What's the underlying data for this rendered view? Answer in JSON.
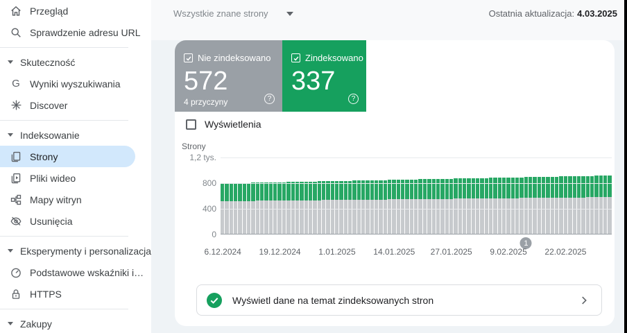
{
  "topbar": {
    "filter_label": "Wszystkie znane strony",
    "last_update_label": "Ostatnia aktualizacja:",
    "last_update_date": "4.03.2025"
  },
  "sidebar": {
    "items": [
      {
        "type": "item",
        "slug": "overview",
        "icon": "home-icon",
        "label": "Przegląd"
      },
      {
        "type": "item",
        "slug": "url-inspection",
        "icon": "search-icon",
        "label": "Sprawdzenie adresu URL"
      },
      {
        "type": "divider"
      },
      {
        "type": "section",
        "slug": "performance",
        "label": "Skuteczność"
      },
      {
        "type": "item",
        "slug": "search-results",
        "icon": "google-g-icon",
        "label": "Wyniki wyszukiwania"
      },
      {
        "type": "item",
        "slug": "discover",
        "icon": "discover-icon",
        "label": "Discover"
      },
      {
        "type": "divider"
      },
      {
        "type": "section",
        "slug": "indexing",
        "label": "Indeksowanie"
      },
      {
        "type": "item",
        "slug": "pages",
        "icon": "pages-icon",
        "label": "Strony",
        "selected": true
      },
      {
        "type": "item",
        "slug": "video-pages",
        "icon": "video-icon",
        "label": "Pliki wideo"
      },
      {
        "type": "item",
        "slug": "sitemaps",
        "icon": "sitemap-icon",
        "label": "Mapy witryn"
      },
      {
        "type": "item",
        "slug": "removals",
        "icon": "eye-off-icon",
        "label": "Usunięcia"
      },
      {
        "type": "divider"
      },
      {
        "type": "section",
        "slug": "experience",
        "label": "Eksperymenty i personalizacja"
      },
      {
        "type": "item",
        "slug": "core-web-vitals",
        "icon": "gauge-icon",
        "label": "Podstawowe wskaźniki i…"
      },
      {
        "type": "item",
        "slug": "https",
        "icon": "lock-icon",
        "label": "HTTPS"
      },
      {
        "type": "divider"
      },
      {
        "type": "section",
        "slug": "shopping",
        "label": "Zakupy"
      }
    ]
  },
  "summary_cards": {
    "not_indexed": {
      "label": "Nie zindeksowano",
      "value": 572,
      "subtitle": "4 przyczyny",
      "color": "#9aa0a6",
      "help_icon": "?"
    },
    "indexed": {
      "label": "Zindeksowano",
      "value": 337,
      "color": "#16a05e",
      "help_icon": "?"
    }
  },
  "impressions_toggle": {
    "label": "Wyświetlenia",
    "checked": false
  },
  "chart_data": {
    "type": "bar",
    "stacked": true,
    "title": "Strony",
    "ylim": [
      0,
      1200
    ],
    "yticks": [
      {
        "label": "1,2 tys.",
        "value": 1200
      },
      {
        "label": "800",
        "value": 800
      },
      {
        "label": "400",
        "value": 400
      },
      {
        "label": "0",
        "value": 0
      }
    ],
    "xtick_labels": [
      {
        "label": "6.12.2024",
        "index": 0
      },
      {
        "label": "19.12.2024",
        "index": 13
      },
      {
        "label": "1.01.2025",
        "index": 26
      },
      {
        "label": "14.01.2025",
        "index": 39
      },
      {
        "label": "27.01.2025",
        "index": 52
      },
      {
        "label": "9.02.2025",
        "index": 65
      },
      {
        "label": "22.02.2025",
        "index": 78
      }
    ],
    "marker": {
      "label": "1",
      "index": 69
    },
    "series": [
      {
        "name": "Nie zindeksowano",
        "color": "#c7cacd",
        "values": [
          508,
          509,
          509,
          510,
          511,
          512,
          512,
          513,
          514,
          515,
          515,
          516,
          517,
          517,
          518,
          519,
          520,
          520,
          521,
          522,
          523,
          523,
          524,
          525,
          526,
          526,
          527,
          528,
          528,
          529,
          530,
          531,
          531,
          532,
          533,
          534,
          534,
          535,
          536,
          536,
          537,
          538,
          539,
          539,
          540,
          541,
          542,
          542,
          543,
          544,
          545,
          545,
          546,
          547,
          547,
          548,
          549,
          550,
          550,
          551,
          551,
          552,
          553,
          554,
          554,
          555,
          556,
          556,
          557,
          558,
          559,
          559,
          560,
          561,
          562,
          562,
          563,
          564,
          564,
          565,
          566,
          567,
          567,
          568,
          569,
          570,
          570,
          571,
          572
        ]
      },
      {
        "name": "Zindeksowano",
        "color": "#27a764",
        "values": [
          278,
          279,
          279,
          280,
          281,
          281,
          282,
          283,
          283,
          284,
          285,
          285,
          286,
          287,
          287,
          288,
          289,
          289,
          290,
          291,
          291,
          292,
          293,
          293,
          294,
          295,
          295,
          296,
          297,
          297,
          298,
          299,
          299,
          300,
          301,
          301,
          302,
          303,
          303,
          304,
          305,
          305,
          306,
          307,
          307,
          308,
          309,
          309,
          310,
          311,
          312,
          312,
          313,
          314,
          314,
          315,
          316,
          316,
          317,
          318,
          318,
          319,
          320,
          320,
          321,
          322,
          322,
          323,
          324,
          324,
          325,
          326,
          326,
          327,
          328,
          328,
          329,
          330,
          330,
          331,
          332,
          332,
          333,
          334,
          334,
          335,
          336,
          336,
          337
        ]
      }
    ]
  },
  "cta": {
    "text": "Wyświetl dane na temat zindeksowanych stron"
  },
  "colors": {
    "selected_item_bg": "#d2e8fc",
    "page_background": "#eff3f6",
    "indexed_green": "#16a05e",
    "not_indexed_gray": "#9aa0a6"
  }
}
